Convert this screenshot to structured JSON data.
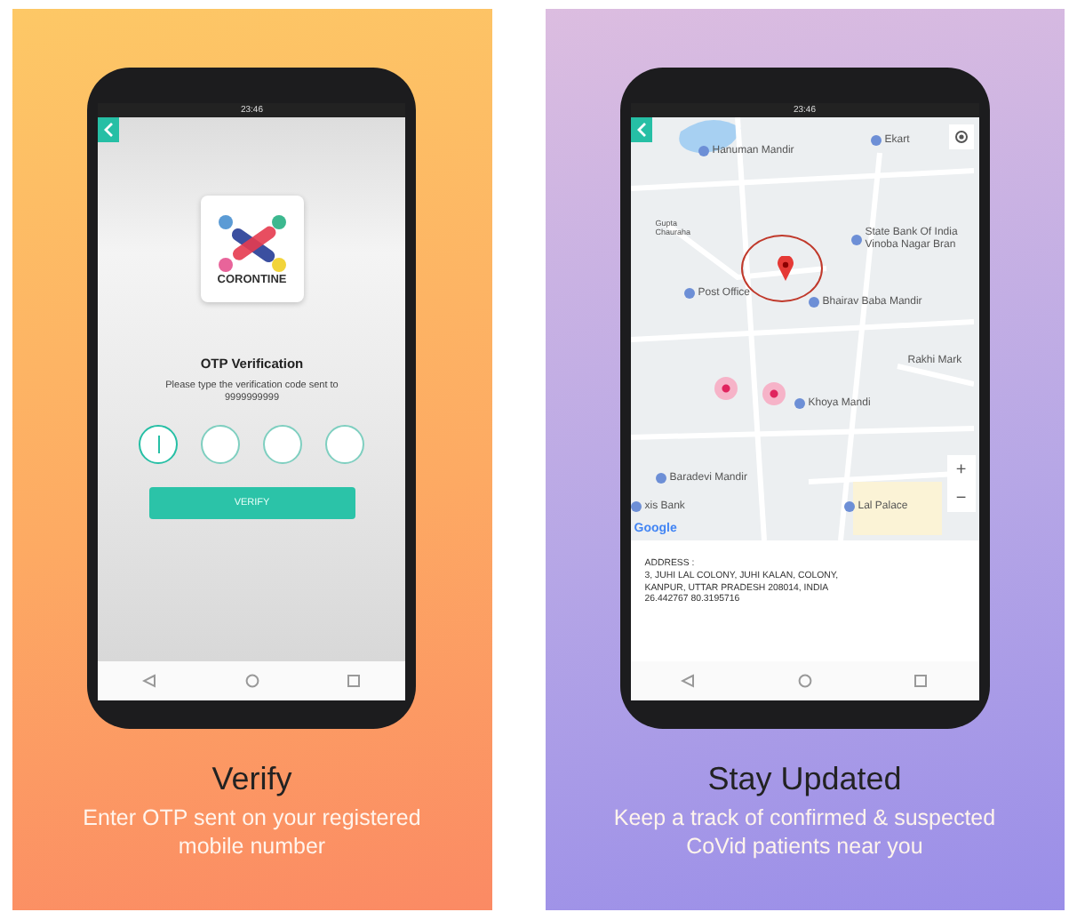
{
  "panels": [
    {
      "kind": "otp",
      "status_time": "23:46",
      "logo_text": "CORONTINE",
      "title": "OTP Verification",
      "instruction": "Please type the verification code sent to  9999999999",
      "otp_boxes": [
        {
          "focused": true
        },
        {
          "focused": false
        },
        {
          "focused": false
        },
        {
          "focused": false
        }
      ],
      "button": "VERIFY",
      "caption": "Verify",
      "subtitle": "Enter OTP sent on your registered mobile number"
    },
    {
      "kind": "map",
      "status_time": "23:46",
      "map_labels": [
        {
          "text": "Hanuman Mandir",
          "kind": "poi"
        },
        {
          "text": "Ekart",
          "kind": "poi"
        },
        {
          "text": "Gupta Chauraha",
          "kind": "plain"
        },
        {
          "text": "State Bank Of India Vinoba Nagar Bran",
          "kind": "poi"
        },
        {
          "text": "Post Office",
          "kind": "poi"
        },
        {
          "text": "Bhairav Baba Mandir",
          "kind": "poi"
        },
        {
          "text": "Rakhi Mark",
          "kind": "plain"
        },
        {
          "text": "Khoya Mandi",
          "kind": "poi"
        },
        {
          "text": "Baradevi Mandir",
          "kind": "poi"
        },
        {
          "text": "xis Bank",
          "kind": "poi"
        },
        {
          "text": "Lal Palace",
          "kind": "poi"
        }
      ],
      "map_credit": "Google",
      "zoom_in": "+",
      "zoom_out": "−",
      "address": [
        "ADDRESS :",
        "3, JUHI LAL COLONY, JUHI KALAN, COLONY,",
        "KANPUR, UTTAR PRADESH 208014, INDIA",
        "26.442767 80.3195716"
      ],
      "caption": "Stay Updated",
      "subtitle": "Keep a track of confirmed & suspected CoVid patients near you"
    }
  ]
}
